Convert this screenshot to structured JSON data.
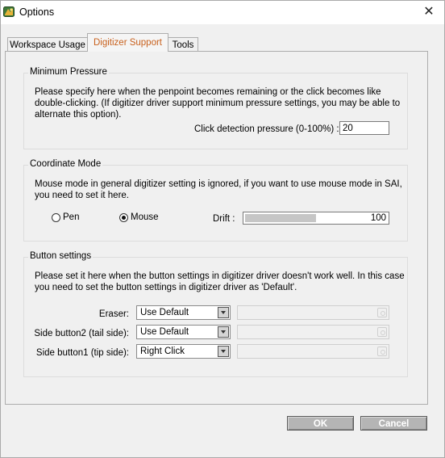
{
  "window": {
    "title": "Options",
    "icon": "sai-app-icon",
    "close_icon": "close-icon"
  },
  "tabs": [
    {
      "label": "Workspace Usage",
      "active": false
    },
    {
      "label": "Digitizer Support",
      "active": true
    },
    {
      "label": "Tools",
      "active": false
    }
  ],
  "accent_color": "#c8601c",
  "min_pressure": {
    "legend": "Minimum Pressure",
    "lines": [
      "Please specify here when the penpoint becomes remaining or the click becomes like",
      "double-clicking. (If digitizer driver support minimum pressure settings, you may be able to",
      "alternate this option)."
    ],
    "field_label": "Click detection pressure (0-100%) :",
    "field_value": "20"
  },
  "coordinate_mode": {
    "legend": "Coordinate Mode",
    "lines": [
      "Mouse mode in general digitizer setting is ignored, if you want to use mouse mode in SAI,",
      "you need to set it here."
    ],
    "radio_pen": "Pen",
    "radio_mouse": "Mouse",
    "selected": "Mouse",
    "drift_label": "Drift :",
    "drift_value": "100",
    "drift_fill_fraction": 0.5
  },
  "button_settings": {
    "legend": "Button settings",
    "lines": [
      "Please set it here when the button settings in digitizer driver doesn't work well. In this case",
      "you need to set the button settings in digitizer driver as 'Default'."
    ],
    "rows": [
      {
        "label": "Eraser:",
        "value": "Use Default"
      },
      {
        "label": "Side button2 (tail side):",
        "value": "Use Default"
      },
      {
        "label": "Side button1 (tip side):",
        "value": "Right Click"
      }
    ]
  },
  "footer": {
    "ok_label": "OK",
    "cancel_label": "Cancel"
  }
}
